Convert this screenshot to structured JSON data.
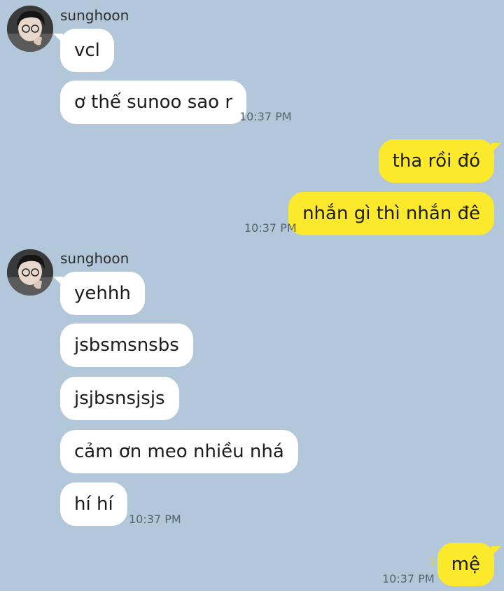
{
  "contact": {
    "name": "sunghoon"
  },
  "groups": [
    {
      "sender": "sunghoon",
      "messages": [
        "vcl",
        "ơ thế sunoo sao r"
      ],
      "time": "10:37 PM"
    },
    {
      "sender": "me",
      "messages": [
        "tha rồi đó",
        "nhắn gì thì nhắn đê"
      ],
      "time": "10:37 PM"
    },
    {
      "sender": "sunghoon",
      "messages": [
        "yehhh",
        "jsbsmsnsbs",
        "jsjbsnsjsjs",
        "cảm ơn meo nhiều nhá",
        "hí hí"
      ],
      "time": "10:37 PM"
    },
    {
      "sender": "me",
      "messages": [
        "mệ"
      ],
      "time": "10:37 PM",
      "unread": "1"
    }
  ],
  "colors": {
    "background": "#b2c7d9",
    "incoming_bubble": "#ffffff",
    "outgoing_bubble": "#fde92c",
    "timestamp": "#556370",
    "unread_count": "#e5d327"
  },
  "icons": {
    "avatar": "profile-photo"
  }
}
